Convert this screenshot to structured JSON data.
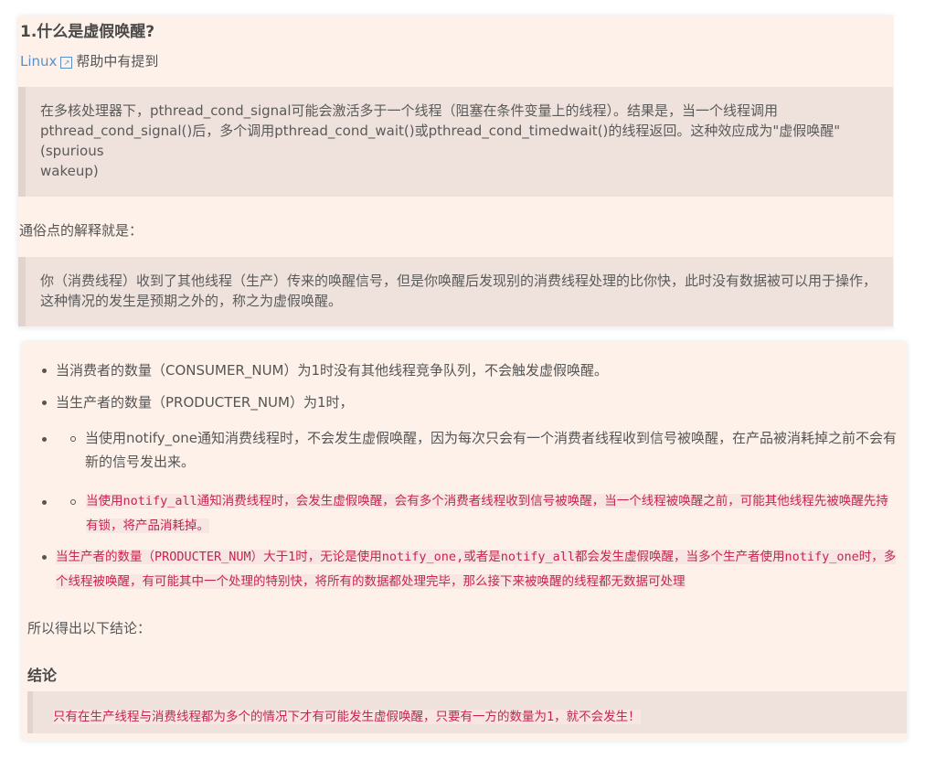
{
  "section1": {
    "title": "1.什么是虚假唤醒?",
    "link_text": "Linux",
    "link_suffix": "帮助中有提到",
    "quote1": "在多核处理器下，pthread_cond_signal可能会激活多于一个线程（阻塞在条件变量上的线程）。结果是，当一个线程调用pthread_cond_signal()后，多个调用pthread_cond_wait()或pthread_cond_timedwait()的线程返回。这种效应成为\"虚假唤醒\"(spurious\nwakeup)",
    "plain": "通俗点的解释就是：",
    "quote2": "你（消费线程）收到了其他线程（生产）传来的唤醒信号，但是你唤醒后发现别的消费线程处理的比你快，此时没有数据被可以用于操作，这种情况的发生是预期之外的，称之为虚假唤醒。"
  },
  "section2": {
    "bullet1": "当消费者的数量（CONSUMER_NUM）为1时没有其他线程竞争队列，不会触发虚假唤醒。",
    "bullet2": "当生产者的数量（PRODUCTER_NUM）为1时，",
    "bullet3": "当使用notify_one通知消费线程时，不会发生虚假唤醒，因为每次只会有一个消费者线程收到信号被唤醒，在产品被消耗掉之前不会有新的信号发出来。",
    "bullet4": "当使用notify_all通知消费线程时，会发生虚假唤醒，会有多个消费者线程收到信号被唤醒，当一个线程被唤醒之前，可能其他线程先被唤醒先持有锁，将产品消耗掉。",
    "bullet5": "当生产者的数量（PRODUCTER_NUM）大于1时，无论是使用notify_one,或者是notify_all都会发生虚假唤醒，当多个生产者使用notify_one时，多个线程被唤醒，有可能其中一个处理的特别快，将所有的数据都处理完毕，那么接下来被唤醒的线程都无数据可处理",
    "plain": "所以得出以下结论：",
    "heading": "结论",
    "conclusion": "只有在生产线程与消费线程都为多个的情况下才有可能发生虚假唤醒，只要有一方的数量为1，就不会发生！"
  }
}
